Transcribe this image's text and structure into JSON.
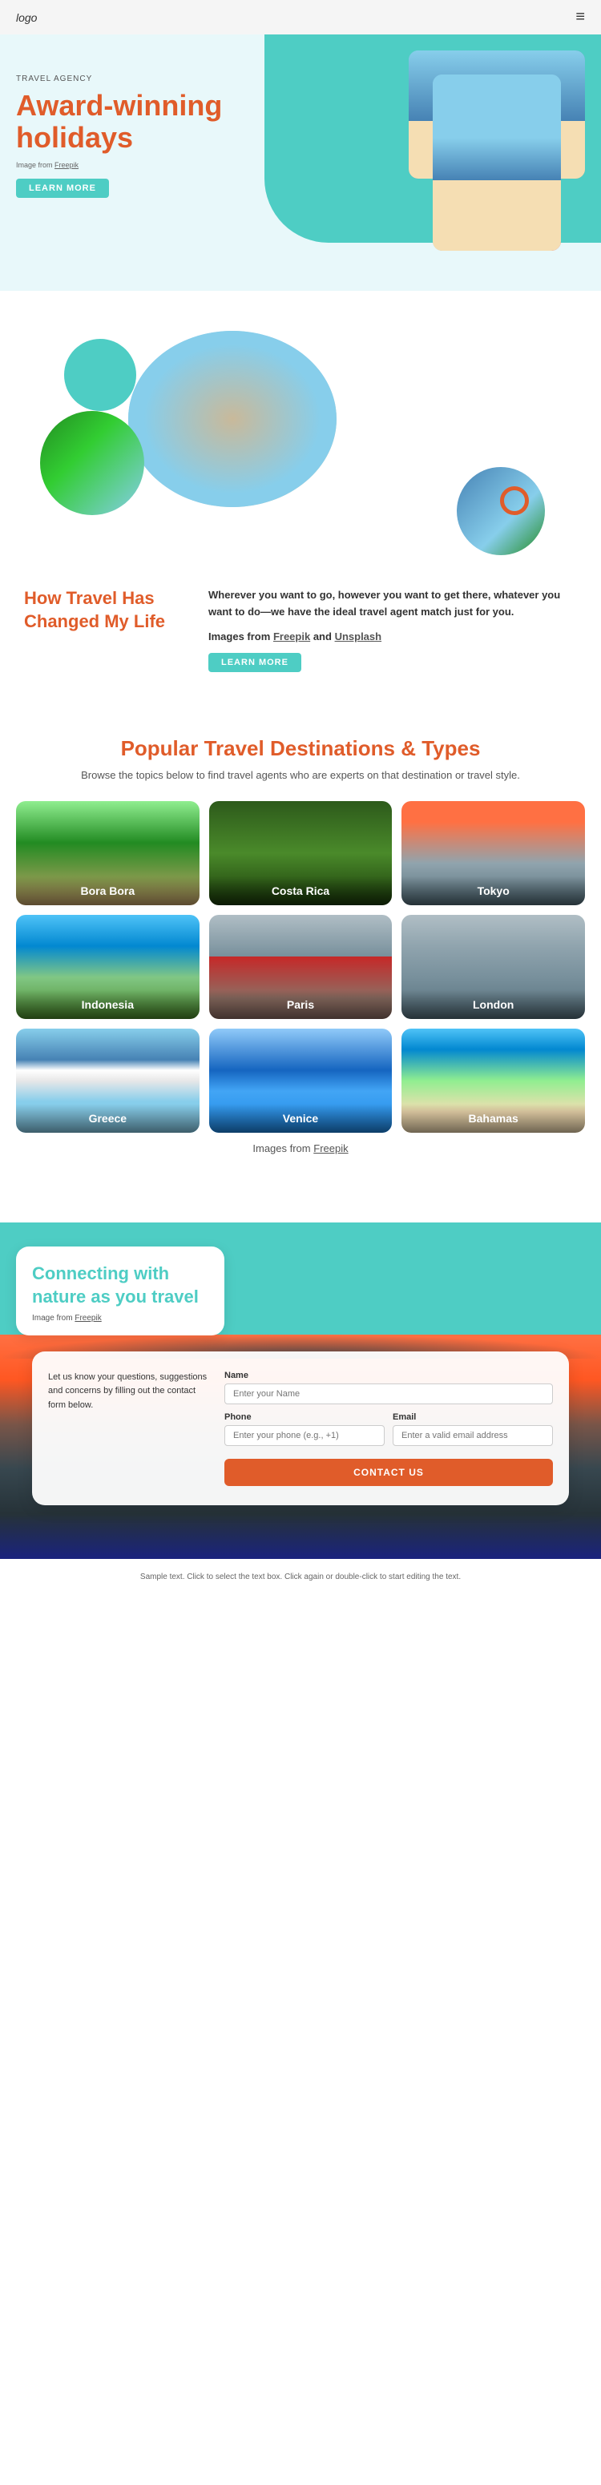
{
  "header": {
    "logo": "logo",
    "menu_icon": "≡"
  },
  "hero": {
    "label": "TRAVEL AGENCY",
    "title": "Award-winning holidays",
    "image_credit_text": "Image from",
    "image_credit_link": "Freepik",
    "learn_more": "LEARN MORE"
  },
  "travel_changed": {
    "heading_line1": "How Travel Has",
    "heading_line2": "Changed My Life",
    "description": "Wherever you want to go, however you want to get there, whatever you want to do—we have the ideal travel agent match just for you.",
    "credits_text": "Images from",
    "credits_link1": "Freepik",
    "credits_and": "and",
    "credits_link2": "Unsplash",
    "learn_more": "LEARN MORE"
  },
  "destinations": {
    "heading": "Popular Travel Destinations & Types",
    "subtext": "Browse the topics below to find travel agents who are experts on that destination or travel style.",
    "items": [
      {
        "label": "Bora Bora",
        "class": "dest-bora"
      },
      {
        "label": "Costa Rica",
        "class": "dest-costa"
      },
      {
        "label": "Tokyo",
        "class": "dest-tokyo"
      },
      {
        "label": "Indonesia",
        "class": "dest-indonesia"
      },
      {
        "label": "Paris",
        "class": "dest-paris"
      },
      {
        "label": "London",
        "class": "dest-london"
      },
      {
        "label": "Greece",
        "class": "dest-greece"
      },
      {
        "label": "Venice",
        "class": "dest-venice"
      },
      {
        "label": "Bahamas",
        "class": "dest-bahamas"
      }
    ],
    "credit_text": "Images from",
    "credit_link": "Freepik"
  },
  "nature": {
    "heading_line1": "Connecting with",
    "heading_line2": "nature as you travel",
    "credit_text": "Image from",
    "credit_link": "Freepik"
  },
  "contact": {
    "intro": "Let us know your questions, suggestions and concerns by filling out the contact form below.",
    "name_label": "Name",
    "name_placeholder": "Enter your Name",
    "phone_label": "Phone",
    "phone_placeholder": "Enter your phone (e.g., +1)",
    "email_label": "Email",
    "email_placeholder": "Enter a valid email address",
    "button": "CONTACT US"
  },
  "footer": {
    "text": "Sample text. Click to select the text box. Click again or double-click to start editing the text."
  }
}
